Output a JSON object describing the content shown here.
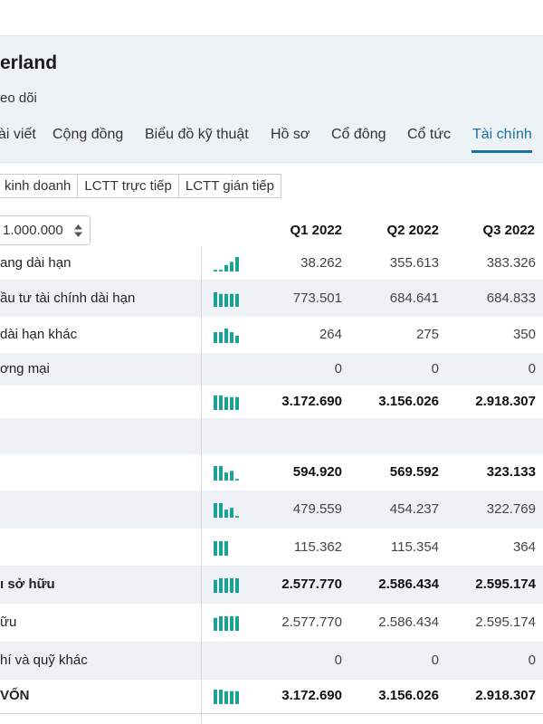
{
  "header": {
    "company": "erland",
    "follow": "eo dõi"
  },
  "tabs": [
    {
      "label": "ài viết",
      "active": false
    },
    {
      "label": "Cộng đồng",
      "active": false
    },
    {
      "label": "Biểu đồ kỹ thuật",
      "active": false
    },
    {
      "label": "Hồ sơ",
      "active": false
    },
    {
      "label": "Cổ đông",
      "active": false
    },
    {
      "label": "Cổ tức",
      "active": false
    },
    {
      "label": "Tài chính",
      "active": true
    }
  ],
  "subtabs": [
    "kinh doanh",
    "LCTT trực tiếp",
    "LCTT gián tiếp"
  ],
  "unit_select": {
    "value": "1.000.000"
  },
  "columns": [
    "Q1 2022",
    "Q2 2022",
    "Q3 2022"
  ],
  "colors": {
    "accent": "#1a73a8",
    "spark": "#1aa394",
    "row_alt": "#eef2f7"
  },
  "rows": [
    {
      "label": "ang dài hạn",
      "values": [
        "38.262",
        "355.613",
        "383.326"
      ],
      "bold": false,
      "alt": false,
      "spark": [
        1,
        1,
        4,
        6,
        9
      ]
    },
    {
      "label": "ầu tư tài chính dài hạn",
      "values": [
        "773.501",
        "684.641",
        "684.833"
      ],
      "bold": false,
      "alt": true,
      "spark": [
        9,
        8,
        8,
        8,
        8
      ]
    },
    {
      "label": "dài hạn khác",
      "values": [
        "264",
        "275",
        "350"
      ],
      "bold": false,
      "alt": false,
      "spark": [
        6,
        6,
        8,
        6,
        4
      ]
    },
    {
      "label": "ơng mại",
      "values": [
        "0",
        "0",
        "0"
      ],
      "bold": false,
      "alt": true,
      "spark": []
    },
    {
      "label": "",
      "values": [
        "3.172.690",
        "3.156.026",
        "2.918.307"
      ],
      "bold": true,
      "alt": false,
      "spark": [
        9,
        9,
        8,
        8,
        8
      ]
    },
    {
      "label": "",
      "values": [
        "",
        "",
        ""
      ],
      "bold": false,
      "alt": true,
      "spark": []
    },
    {
      "label": "",
      "values": [
        "594.920",
        "569.592",
        "323.133"
      ],
      "bold": true,
      "alt": false,
      "spark": [
        9,
        9,
        5,
        6,
        1
      ]
    },
    {
      "label": "",
      "values": [
        "479.559",
        "454.237",
        "322.769"
      ],
      "bold": false,
      "alt": true,
      "spark": [
        9,
        9,
        5,
        6,
        1
      ]
    },
    {
      "label": "",
      "values": [
        "115.362",
        "115.354",
        "364"
      ],
      "bold": false,
      "alt": false,
      "spark": [
        9,
        9,
        9
      ]
    },
    {
      "label": "ı sở hữu",
      "values": [
        "2.577.770",
        "2.586.434",
        "2.595.174"
      ],
      "bold": true,
      "alt": true,
      "spark": [
        8,
        9,
        9,
        9,
        9
      ]
    },
    {
      "label": "ữu",
      "values": [
        "2.577.770",
        "2.586.434",
        "2.595.174"
      ],
      "bold": false,
      "alt": false,
      "spark": [
        8,
        9,
        9,
        9,
        9
      ]
    },
    {
      "label": "hí và quỹ khác",
      "values": [
        "0",
        "0",
        "0"
      ],
      "bold": false,
      "alt": true,
      "spark": []
    },
    {
      "label": "VỐN",
      "values": [
        "3.172.690",
        "3.156.026",
        "2.918.307"
      ],
      "bold": true,
      "alt": false,
      "spark": [
        9,
        9,
        8,
        8,
        8
      ]
    }
  ]
}
